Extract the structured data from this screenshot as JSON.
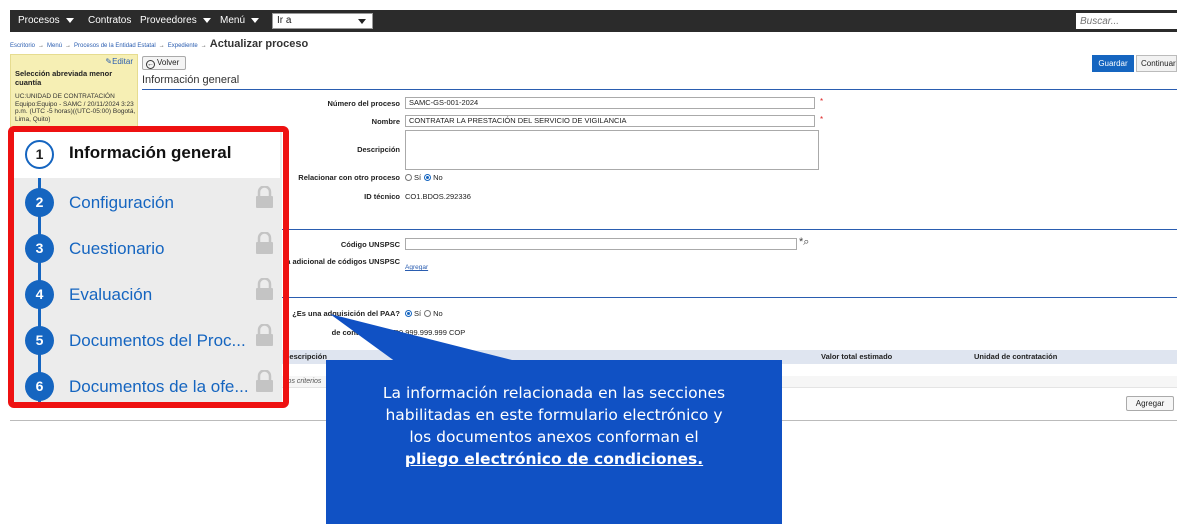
{
  "topnav": {
    "items": [
      {
        "label": "Procesos",
        "dropdown": true
      },
      {
        "label": "Contratos",
        "dropdown": false
      },
      {
        "label": "Proveedores",
        "dropdown": true
      },
      {
        "label": "Menú",
        "dropdown": true
      }
    ],
    "goto_value": "Ir a",
    "search_placeholder": "Buscar..."
  },
  "breadcrumb": {
    "links": [
      "Escritorio",
      "Menú",
      "Procesos de la Entidad Estatal",
      "Expediente"
    ],
    "current": "Actualizar proceso"
  },
  "left_card": {
    "edit_label": "Editar",
    "title": "Selección abreviada menor cuantía",
    "meta": "UC:UNIDAD DE CONTRATACIÓN Equipo:Equipo - SAMC / 20/11/2024 3:23 p.m. (UTC -5 horas)((UTC-05:00) Bogotá, Lima, Quito)"
  },
  "actions": {
    "volver": "Volver",
    "guardar": "Guardar",
    "continuar": "Continuar",
    "agregar": "Agregar",
    "agregar_link": "Agregar"
  },
  "section_title": "Información general",
  "form": {
    "numero_label": "Número del proceso",
    "numero_value": "SAMC-GS-001-2024",
    "nombre_label": "Nombre",
    "nombre_value": "CONTRATAR LA PRESTACIÓN DEL SERVICIO DE VIGILANCIA",
    "descripcion_label": "Descripción",
    "relacionar_label": "Relacionar con otro proceso",
    "si": "Sí",
    "no": "No",
    "id_label": "ID técnico",
    "id_value": "CO1.BDOS.292336",
    "unspsc_label": "Código UNSPSC",
    "unspsc_extra_label": "a adicional de códigos UNSPSC",
    "paa_label": "¿Es una adquisición del PAA?",
    "contratacion_label": "de contratación Me",
    "contratacion_value": "999.999.999.999.999 COP"
  },
  "table": {
    "headers": [
      "Descripción",
      "Valor total estimado",
      "Unidad de contratación"
    ],
    "row_text": "los criterios"
  },
  "steps": [
    {
      "number": "1",
      "label": "Información general",
      "active": true,
      "locked": false
    },
    {
      "number": "2",
      "label": "Configuración",
      "active": false,
      "locked": true
    },
    {
      "number": "3",
      "label": "Cuestionario",
      "active": false,
      "locked": true
    },
    {
      "number": "4",
      "label": "Evaluación",
      "active": false,
      "locked": true
    },
    {
      "number": "5",
      "label": "Documentos del Proc...",
      "active": false,
      "locked": true
    },
    {
      "number": "6",
      "label": "Documentos de la ofe...",
      "active": false,
      "locked": true
    }
  ],
  "callout": {
    "line1": "La información relacionada en las secciones",
    "line2": "habilitadas en este formulario electrónico y",
    "line3": "los documentos anexos conforman el",
    "emphasis": "pliego electrónico de condiciones."
  },
  "colors": {
    "accent": "#1565c0",
    "highlight_border": "#ee1111",
    "callout_bg": "#1051c4",
    "nav_bg": "#2b2b2b",
    "card_bg": "#f6efb4"
  }
}
